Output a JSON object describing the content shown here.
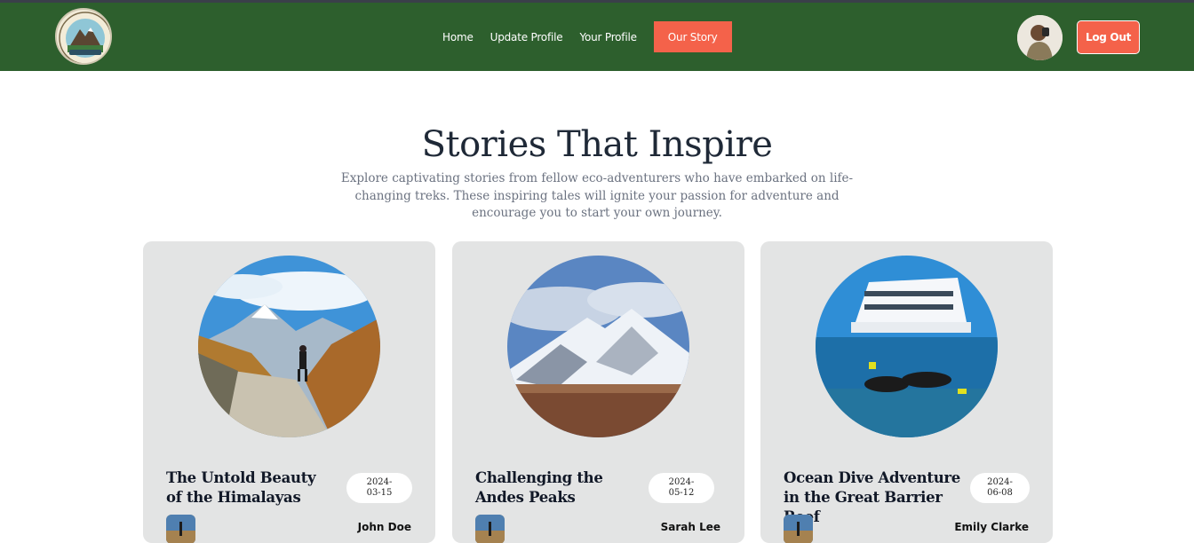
{
  "navbar": {
    "logo_label": "logo",
    "links": [
      {
        "label": "Home"
      },
      {
        "label": "Update Profile"
      },
      {
        "label": "Your Profile"
      },
      {
        "label": "Our Story"
      }
    ],
    "logout_label": "Log Out"
  },
  "hero": {
    "title": "Stories That Inspire",
    "subtitle": "Explore captivating stories from fellow eco-adventurers who have embarked on life-changing treks. These inspiring tales will ignite your passion for adventure and encourage you to start your own journey."
  },
  "stories": [
    {
      "title": "The Untold Beauty of the Himalayas",
      "date": "2024-03-15",
      "author": "John Doe"
    },
    {
      "title": "Challenging the Andes Peaks",
      "date": "2024-05-12",
      "author": "Sarah Lee"
    },
    {
      "title": "Ocean Dive Adventure in the Great Barrier Reef",
      "date": "2024-06-08",
      "author": "Emily Clarke"
    }
  ],
  "colors": {
    "navbar": "#2d5f2d",
    "accent": "#f4624a",
    "card": "#e3e4e4"
  }
}
